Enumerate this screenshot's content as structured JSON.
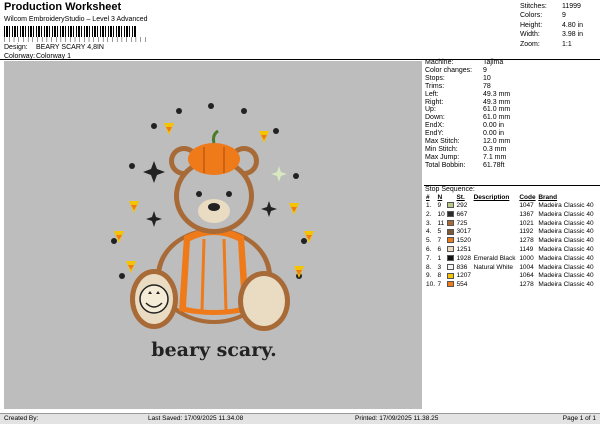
{
  "header": {
    "title": "Production Worksheet",
    "subtitle": "Wilcom EmbroideryStudio – Level 3 Advanced",
    "barcode_text": "| | | | | | | | | | | | | | | | | | | | | | | | | | | | | | |",
    "design_label": "Design:",
    "design_value": "BEARY SCARY 4,8IN",
    "colorway_label": "Colorway:",
    "colorway_value": "Colorway 1"
  },
  "stats": [
    {
      "label": "Stitches:",
      "value": "11999"
    },
    {
      "label": "Colors:",
      "value": "9"
    },
    {
      "label": "Height:",
      "value": "4.80 in"
    },
    {
      "label": "Width:",
      "value": "3.98 in"
    },
    {
      "label": "Zoom:",
      "value": "1:1"
    }
  ],
  "design_text": "beary scary.",
  "info": [
    {
      "label": "Machine:",
      "value": "Tajima"
    },
    {
      "label": "Color changes:",
      "value": "9"
    },
    {
      "label": "Stops:",
      "value": "10"
    },
    {
      "label": "Trims:",
      "value": "78"
    },
    {
      "label": "Left:",
      "value": "49.3 mm"
    },
    {
      "label": "Right:",
      "value": "49.3 mm"
    },
    {
      "label": "Up:",
      "value": "61.0 mm"
    },
    {
      "label": "Down:",
      "value": "61.0 mm"
    },
    {
      "label": "EndX:",
      "value": "0.00 in"
    },
    {
      "label": "EndY:",
      "value": "0.00 in"
    },
    {
      "label": "Max Stitch:",
      "value": "12.0 mm"
    },
    {
      "label": "Min Stitch:",
      "value": "0.3 mm"
    },
    {
      "label": "Max Jump:",
      "value": "7.1 mm"
    },
    {
      "label": "Total Bobbin:",
      "value": "61.78ft"
    }
  ],
  "stop_sequence": {
    "title": "Stop Sequence:",
    "headers": [
      "#",
      "N",
      "",
      "St.",
      "Description",
      "Code",
      "Brand"
    ],
    "rows": [
      {
        "n": "1.",
        "needle": "9",
        "color": "#b8c98a",
        "code_num": "292",
        "desc": "",
        "code": "1047",
        "brand": "Madeira Classic 40"
      },
      {
        "n": "2.",
        "needle": "10",
        "color": "#2a2a2a",
        "code_num": "667",
        "desc": "",
        "code": "1367",
        "brand": "Madeira Classic 40"
      },
      {
        "n": "3.",
        "needle": "11",
        "color": "#a86a36",
        "code_num": "725",
        "desc": "",
        "code": "1021",
        "brand": "Madeira Classic 40"
      },
      {
        "n": "4.",
        "needle": "5",
        "color": "#7c5a36",
        "code_num": "3017",
        "desc": "",
        "code": "1192",
        "brand": "Madeira Classic 40"
      },
      {
        "n": "5.",
        "needle": "7",
        "color": "#ee7a1a",
        "code_num": "1520",
        "desc": "",
        "code": "1278",
        "brand": "Madeira Classic 40"
      },
      {
        "n": "6.",
        "needle": "6",
        "color": "#e9dcc2",
        "code_num": "1251",
        "desc": "",
        "code": "1149",
        "brand": "Madeira Classic 40"
      },
      {
        "n": "7.",
        "needle": "1",
        "color": "#111111",
        "code_num": "1928",
        "desc": "Emerald Black",
        "code": "1000",
        "brand": "Madeira Classic 40"
      },
      {
        "n": "8.",
        "needle": "3",
        "color": "#f5f5f5",
        "code_num": "836",
        "desc": "Natural White",
        "code": "1004",
        "brand": "Madeira Classic 40"
      },
      {
        "n": "9.",
        "needle": "8",
        "color": "#f4c400",
        "code_num": "1207",
        "desc": "",
        "code": "1064",
        "brand": "Madeira Classic 40"
      },
      {
        "n": "10.",
        "needle": "7",
        "color": "#ee7a1a",
        "code_num": "554",
        "desc": "",
        "code": "1278",
        "brand": "Madeira Classic 40"
      }
    ]
  },
  "footer": {
    "created_by": "Created By:",
    "last_saved": "Last Saved: 17/09/2025 11.34.08",
    "printed": "Printed: 17/09/2025 11.38.25",
    "page": "Page 1 of 1"
  }
}
